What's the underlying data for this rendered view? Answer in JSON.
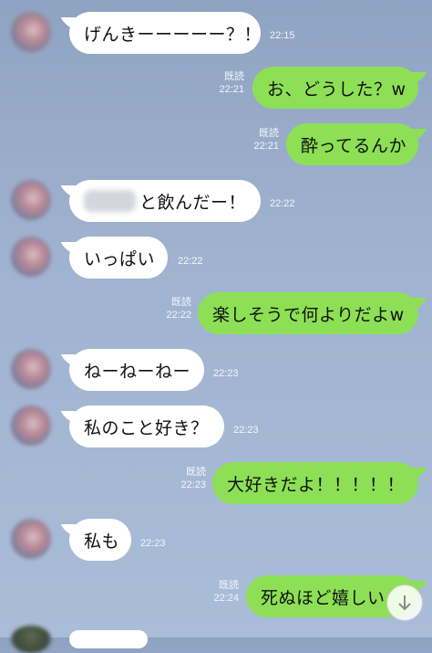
{
  "read_label": "既読",
  "messages": [
    {
      "side": "in",
      "text": "げんきーーーーー？！",
      "time": "22:15"
    },
    {
      "side": "out",
      "text": "お、どうした？w",
      "time": "22:21",
      "read": true
    },
    {
      "side": "out",
      "text": "酔ってるんか",
      "time": "22:21",
      "read": true
    },
    {
      "side": "in",
      "text": "と飲んだー！",
      "time": "22:22",
      "name_blurred": true
    },
    {
      "side": "in",
      "text": "いっぱい",
      "time": "22:22"
    },
    {
      "side": "out",
      "text": "楽しそうで何よりだよw",
      "time": "22:22",
      "read": true
    },
    {
      "side": "in",
      "text": "ねーねーねー",
      "time": "22:23"
    },
    {
      "side": "in",
      "text": "私のこと好き？",
      "time": "22:23"
    },
    {
      "side": "out",
      "text": "大好きだよ！！！！！",
      "time": "22:23",
      "read": true
    },
    {
      "side": "in",
      "text": "私も",
      "time": "22:23"
    },
    {
      "side": "out",
      "text": "死ぬほど嬉しい",
      "time": "22:24",
      "read": true
    }
  ],
  "icons": {
    "scroll_down": "arrow-down-icon"
  },
  "colors": {
    "incoming": "#ffffff",
    "outgoing": "#8de055",
    "background": "#9fb3d0"
  }
}
